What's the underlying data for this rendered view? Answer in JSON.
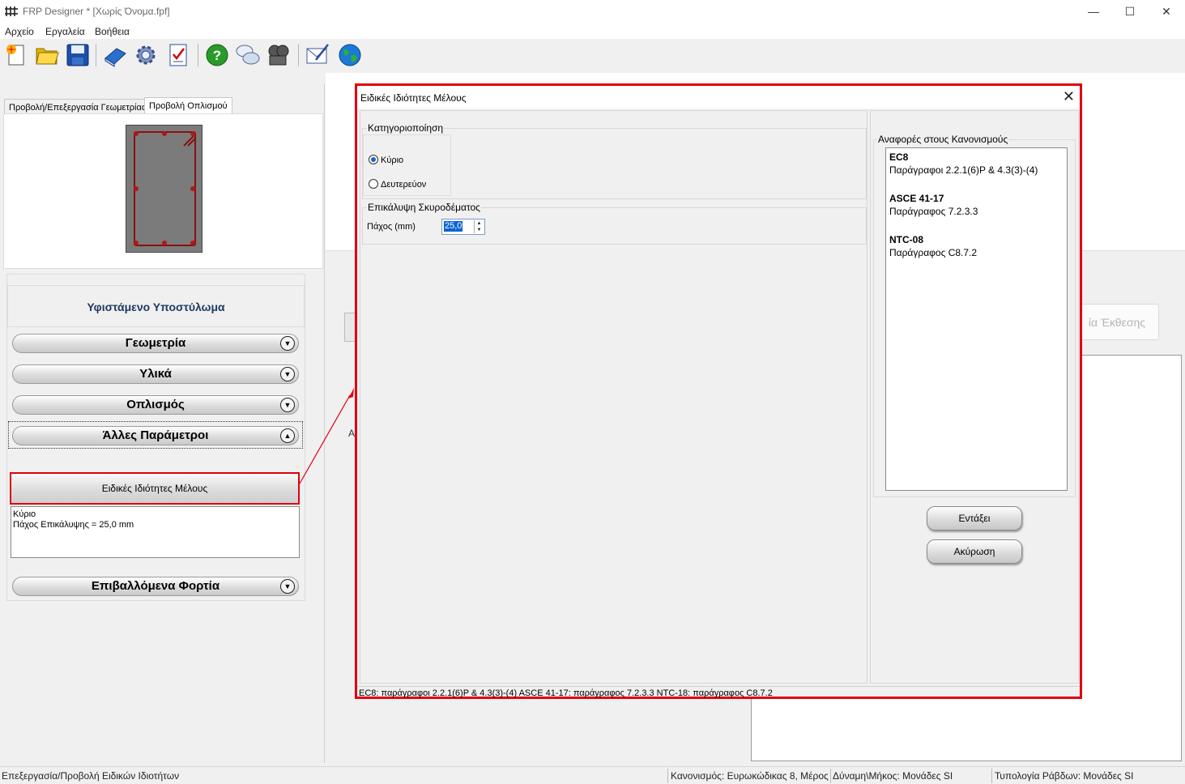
{
  "window": {
    "title": "FRP Designer * [Χωρίς Όνομα.fpf]",
    "minimize": "—",
    "maximize": "☐",
    "close": "✕"
  },
  "menu": [
    "Αρχείο",
    "Εργαλεία",
    "Βοήθεια"
  ],
  "toolbar": {
    "icons": [
      "new-file-icon",
      "open-folder-icon",
      "save-icon",
      "book-icon",
      "gear-icon",
      "checklist-icon",
      "help-icon",
      "chat-icon",
      "film-icon",
      "email-icon",
      "globe-icon"
    ]
  },
  "left": {
    "tabs": [
      "Προβολή/Επεξεργασία Γεωμετρίας",
      "Προβολή Οπλισμού"
    ],
    "header": "Υφιστάμενο Υποστύλωμα",
    "sections": {
      "geometry": "Γεωμετρία",
      "materials": "Υλικά",
      "reinforcement": "Οπλισμός",
      "other": "Άλλες Παράμετροι",
      "loads": "Επιβαλλόμενα Φορτία"
    },
    "special_button": "Ειδικές Ιδιότητες Μέλους",
    "special_summary": [
      "Κύριο",
      "Πάχος Επικάλυψης = 25,0 mm"
    ]
  },
  "background": {
    "report_button_partial": "ία Έκθεσης",
    "letter": "Α"
  },
  "dialog": {
    "title": "Ειδικές Ιδιότητες Μέλους",
    "close": "✕",
    "classification": {
      "label": "Κατηγοριοποίηση",
      "options": [
        "Κύριο",
        "Δευτερεύον"
      ],
      "selected": "Κύριο"
    },
    "cover": {
      "label": "Επικάλυψη Σκυροδέματος",
      "thickness_label": "Πάχος (mm)",
      "thickness_value": "25,0"
    },
    "references": {
      "label": "Αναφορές στους Κανονισμούς",
      "items": [
        {
          "code": "EC8",
          "text": "Παράγραφοι 2.2.1(6)P & 4.3(3)-(4)"
        },
        {
          "code": "ASCE 41-17",
          "text": "Παράγραφος 7.2.3.3"
        },
        {
          "code": "NTC-08",
          "text": "Παράγραφος C8.7.2"
        }
      ]
    },
    "ok": "Εντάξει",
    "cancel": "Ακύρωση",
    "status": "EC8: παράγραφοι 2.2.1(6)P & 4.3(3)-(4) ASCE 41-17: παράγραφος 7.2.3.3 NTC-18: παράγραφος C8.7.2"
  },
  "statusbar": {
    "left": "Επεξεργασία/Προβολή Ειδικών Ιδιοτήτων",
    "code": "Κανονισμός: Ευρωκώδικας 8, Μέρος",
    "units": "Δύναμη\\Μήκος: Μονάδες SI",
    "bars": "Τυπολογία Ράβδων: Μονάδες SI"
  },
  "colors": {
    "highlight": "#e0000f",
    "header_text": "#1f3a60",
    "selection": "#0a64d0"
  }
}
